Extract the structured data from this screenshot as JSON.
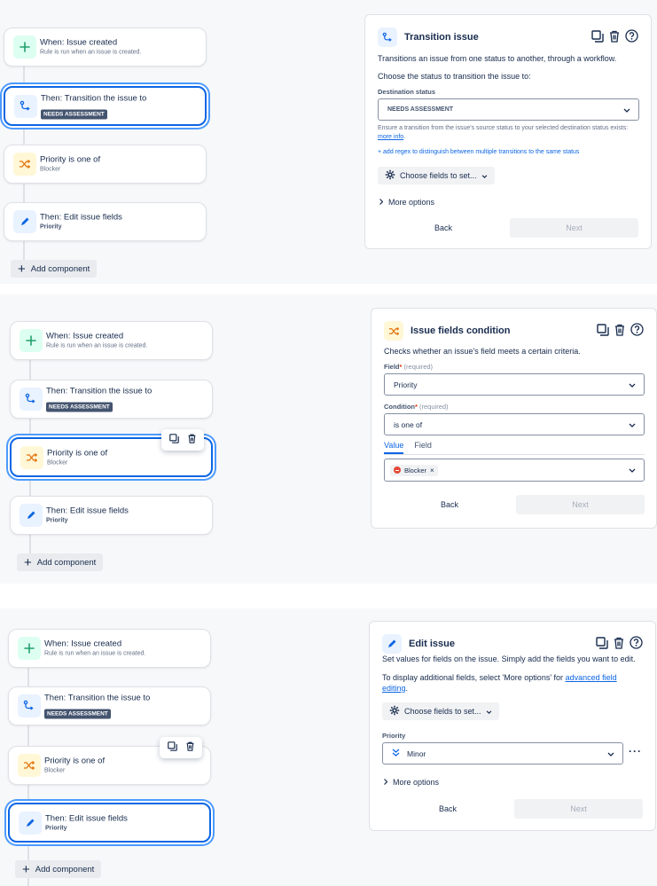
{
  "rule": {
    "trigger_title": "When: Issue created",
    "trigger_sub": "Rule is run when an issue is created.",
    "transition_title": "Then: Transition the issue to",
    "transition_status": "NEEDS ASSESSMENT",
    "condition_title": "Priority is one of",
    "condition_sub": "Blocker",
    "edit_title": "Then: Edit issue fields",
    "edit_sub": "Priority",
    "add_component": "Add component"
  },
  "panel1": {
    "title": "Transition issue",
    "desc": "Transitions an issue from one status to another, through a workflow.",
    "choose": "Choose the status to transition the issue to:",
    "dest_label": "Destination status",
    "dest_value": "NEEDS ASSESSMENT",
    "help_text": "Ensure a transition from the issue's source status to your selected destination status exists:",
    "help_link": "more info",
    "regex_link": "+ add regex to distinguish between multiple transitions to the same status",
    "fields_btn": "Choose fields to set...",
    "more_options": "More options",
    "back": "Back",
    "next": "Next"
  },
  "panel2": {
    "title": "Issue fields condition",
    "desc": "Checks whether an issue's field meets a certain criteria.",
    "field_label": "Field",
    "required": "(required)",
    "field_value": "Priority",
    "condition_label": "Condition",
    "condition_value": "is one of",
    "tab_value": "Value",
    "tab_field": "Field",
    "chip_value": "Blocker",
    "back": "Back",
    "next": "Next"
  },
  "panel3": {
    "title": "Edit issue",
    "desc": "Set values for fields on the issue. Simply add the fields you want to edit.",
    "display_text": "To display additional fields, select 'More options' for",
    "display_link_1": "advanced field",
    "display_link_2": "editing",
    "display_period": ".",
    "fields_btn": "Choose fields to set...",
    "priority_label": "Priority",
    "priority_value": "Minor",
    "more_options": "More options",
    "back": "Back",
    "next": "Next"
  },
  "colors": {
    "selected_border": "#0c66e4",
    "selected_ring": "#4c9aff",
    "lozenge_bg": "#44546f",
    "green_icon": "#22a06b",
    "blue_icon": "#0c66e4",
    "orange_icon": "#e2740e",
    "blocker_red": "#e34935"
  },
  "icons": {
    "trigger": "plus-icon",
    "transition": "transition-arrow-icon",
    "condition": "shuffle-icon",
    "edit": "pencil-icon",
    "copy": "copy-icon",
    "delete": "trash-icon",
    "help": "help-icon",
    "gear": "gear-icon",
    "chevron": "chevron-down-icon",
    "priority_minor": "chevron-double-down-icon",
    "more": "more-dots-icon"
  }
}
